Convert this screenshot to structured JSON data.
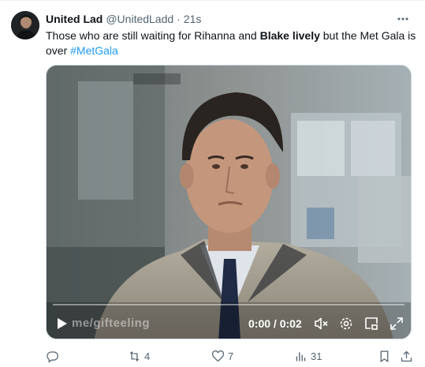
{
  "tweet": {
    "author_name": "United Lad",
    "handle": "@UnitedLadd",
    "separator": "·",
    "time": "21s",
    "text_part1": "Those who are still waiting for Rihanna and ",
    "text_bold": "Blake lively",
    "text_part2": " but the Met Gala is over ",
    "hashtag": "#MetGala"
  },
  "video": {
    "watermark": "me/gifteeling",
    "time_display": "0:00 / 0:02",
    "progress_fraction": 0
  },
  "actions": {
    "replies": "",
    "reposts": "4",
    "likes": "7",
    "views": "31"
  },
  "icons": {
    "more": "more-dots-icon",
    "play": "play-icon",
    "mute": "volume-muted-icon",
    "settings": "settings-gear-icon",
    "pip": "picture-in-picture-icon",
    "fullscreen": "fullscreen-icon",
    "reply": "reply-bubble-icon",
    "repost": "repost-icon",
    "like": "heart-icon",
    "views": "views-bar-chart-icon",
    "bookmark": "bookmark-icon",
    "share": "share-upload-icon"
  },
  "colors": {
    "link": "#1d9bf0",
    "secondary_text": "#536471",
    "primary_text": "#0f1419"
  }
}
